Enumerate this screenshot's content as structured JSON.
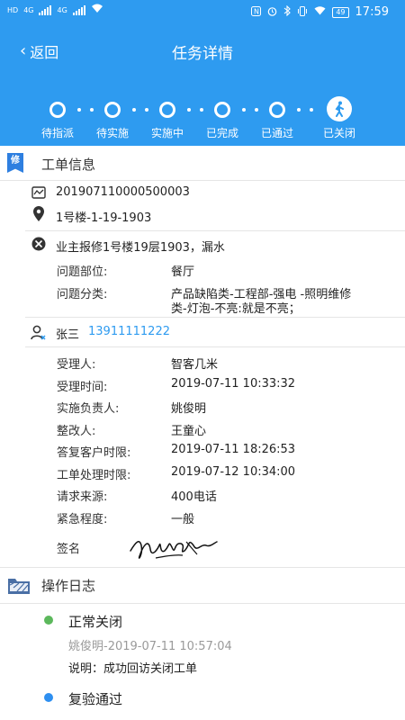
{
  "status_bar": {
    "left_labels": [
      "HD",
      "4G",
      "4G"
    ],
    "time": "17:59",
    "battery": "49",
    "icons": [
      "nfc-icon",
      "alarm-icon",
      "bluetooth-icon",
      "vibrate-icon",
      "wifi-icon",
      "battery-icon"
    ]
  },
  "nav": {
    "back_label": "返回",
    "title": "任务详情"
  },
  "steps": {
    "labels": [
      "待指派",
      "待实施",
      "实施中",
      "已完成",
      "已通过",
      "已关闭"
    ],
    "current_index": 5
  },
  "work_order": {
    "section_title": "工单信息",
    "badge": "修",
    "order_number": "201907110000500003",
    "location": "1号楼-1-19-1903",
    "description": "业主报修1号楼19层1903，漏水",
    "problem_location_label": "问题部位:",
    "problem_location_value": "餐厅",
    "problem_category_label": "问题分类:",
    "problem_category_line1": "产品缺陷类-工程部-强电 -照明维修",
    "problem_category_line2": "类-灯泡-不亮:就是不亮；",
    "contact_name": "张三",
    "contact_phone": "13911111222",
    "details": [
      {
        "label": "受理人:",
        "value": "智客几米"
      },
      {
        "label": "受理时间:",
        "value": "2019-07-11 10:33:32"
      },
      {
        "label": "实施负责人:",
        "value": "姚俊明"
      },
      {
        "label": "整改人:",
        "value": "王童心"
      },
      {
        "label": "答复客户时限:",
        "value": "2019-07-11 18:26:53"
      },
      {
        "label": "工单处理时限:",
        "value": "2019-07-12 10:34:00"
      },
      {
        "label": "请求来源:",
        "value": "400电话"
      },
      {
        "label": "紧急程度:",
        "value": "一般"
      }
    ],
    "signature_label": "签名"
  },
  "log": {
    "section_title": "操作日志",
    "entries": [
      {
        "title": "正常关闭",
        "meta": "姚俊明-2019-07-11 10:57:04",
        "desc": "说明：成功回访关闭工单",
        "color": "#5cb85c"
      },
      {
        "title": "复验通过",
        "color": "#2e8ff0"
      }
    ]
  },
  "colors": {
    "header": "#2e9bf0",
    "accent": "#2e9bf0"
  }
}
